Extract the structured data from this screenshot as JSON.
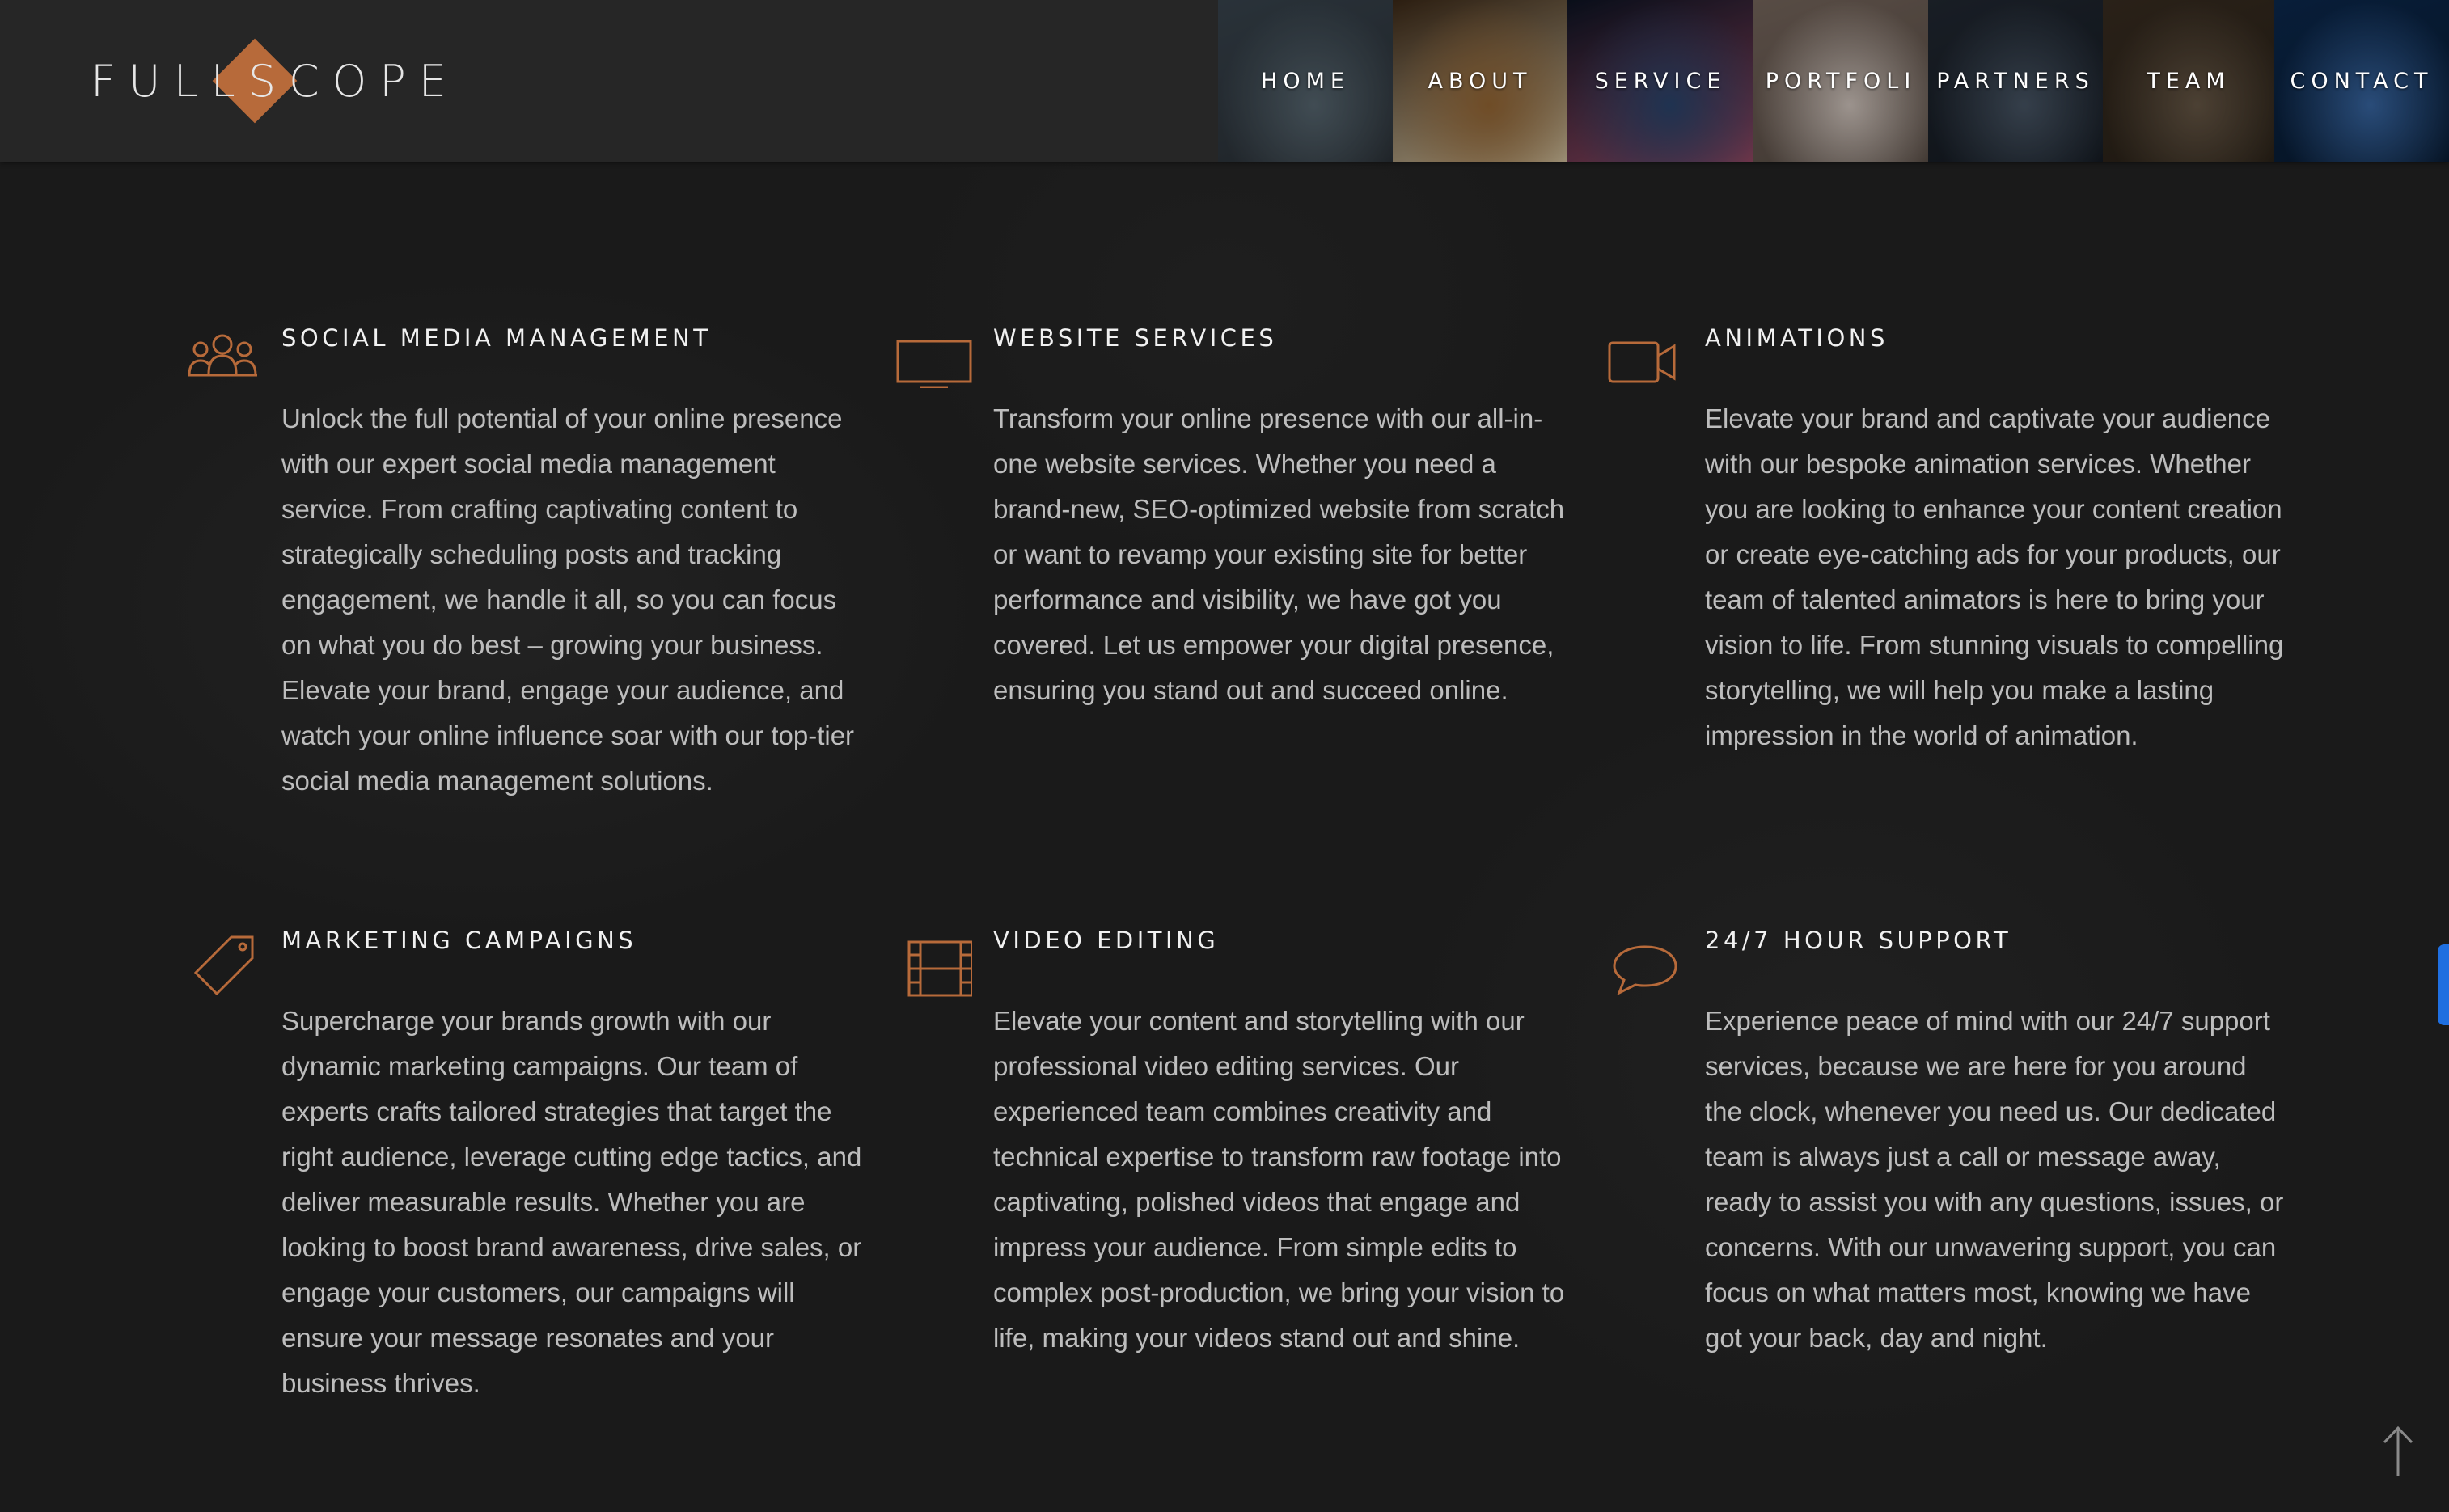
{
  "brand": {
    "logo_text": "FULLSCOPE",
    "accent": "#b76a3a"
  },
  "nav": [
    {
      "label": "HOME",
      "tile": [
        "#3a4650",
        "#5a6a74",
        "#2b3137"
      ]
    },
    {
      "label": "ABOUT",
      "tile": [
        "#3d2a18",
        "#9a6a36",
        "#d8c7a4"
      ]
    },
    {
      "label": "SERVICE",
      "tile": [
        "#0d1424",
        "#2c4770",
        "#9a4a66"
      ]
    },
    {
      "label": "PORTFOLI",
      "tile": [
        "#7a6a60",
        "#d8ccc4",
        "#5a4e46"
      ]
    },
    {
      "label": "PARTNERS",
      "tile": [
        "#232a34",
        "#4a5868",
        "#141a22"
      ]
    },
    {
      "label": "TEAM",
      "tile": [
        "#3a2e22",
        "#6a5a48",
        "#2a2218"
      ]
    },
    {
      "label": "CONTACT",
      "tile": [
        "#0c2a50",
        "#3a6aa8",
        "#081a30"
      ]
    }
  ],
  "services": [
    {
      "icon": "people-group-icon",
      "title": "SOCIAL MEDIA MANAGEMENT",
      "body": "Unlock the full potential of your online presence with our expert social media management service. From crafting captivating content to strategically scheduling posts and tracking engagement, we handle it all, so you can focus on what you do best – growing your business. Elevate your brand, engage your audience, and watch your online influence soar with our top-tier social media management solutions."
    },
    {
      "icon": "monitor-icon",
      "title": "WEBSITE SERVICES",
      "body": "Transform your online presence with our all-in-one website services. Whether you need a brand-new, SEO-optimized website from scratch or want to revamp your existing site for better performance and visibility, we have got you covered. Let us empower your digital presence, ensuring you stand out and succeed online."
    },
    {
      "icon": "video-camera-icon",
      "title": "ANIMATIONS",
      "body": "Elevate your brand and captivate your audience with our bespoke animation services. Whether you are looking to enhance your content creation or create eye-catching ads for your products, our team of talented animators is here to bring your vision to life. From stunning visuals to compelling storytelling, we will help you make a lasting impression in the world of animation."
    },
    {
      "icon": "price-tag-icon",
      "title": "MARKETING CAMPAIGNS",
      "body": "Supercharge your brands growth with our dynamic marketing campaigns. Our team of experts crafts tailored strategies that target the right audience, leverage cutting edge tactics, and deliver measurable results. Whether you are looking to boost brand awareness, drive sales, or engage your customers, our campaigns will ensure your message resonates and your business thrives."
    },
    {
      "icon": "film-strip-icon",
      "title": "VIDEO EDITING",
      "body": "Elevate your content and storytelling with our professional video editing services. Our experienced team combines creativity and technical expertise to transform raw footage into captivating, polished videos that engage and impress your audience. From simple edits to complex post-production, we bring your vision to life, making your videos stand out and shine."
    },
    {
      "icon": "speech-bubble-icon",
      "title": "24/7 HOUR SUPPORT",
      "body": "Experience peace of mind with our 24/7 support services, because we are here for you around the clock, whenever you need us. Our dedicated team is always just a call or message away, ready to assist you with any questions, issues, or concerns. With our unwavering support, you can focus on what matters most, knowing we have got your back, day and night."
    }
  ]
}
